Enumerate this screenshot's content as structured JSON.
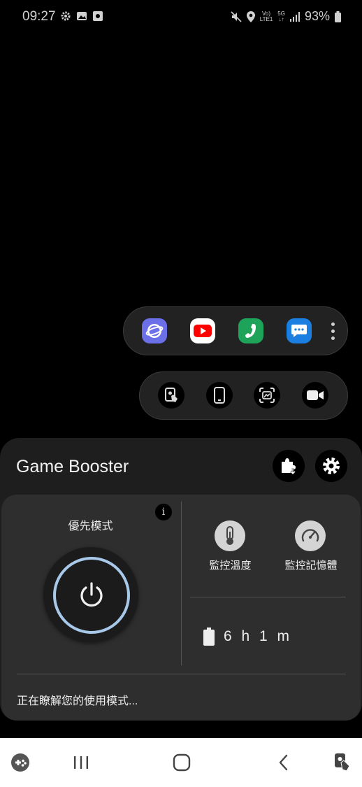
{
  "status_bar": {
    "time": "09:27",
    "battery_percent": "93%",
    "volte_top": "Vo)",
    "volte_bottom": "LTE1",
    "network_top": "5G",
    "network_bottom": "↓↑"
  },
  "floating_apps": [
    {
      "name": "Samsung Internet",
      "icon": "internet-icon",
      "color": "#6b6fe8"
    },
    {
      "name": "YouTube",
      "icon": "youtube-icon",
      "color": "#ffffff"
    },
    {
      "name": "Phone",
      "icon": "phone-icon",
      "color": "#1ea35a"
    },
    {
      "name": "Messages",
      "icon": "messages-icon",
      "color": "#1a7fe0"
    }
  ],
  "tools": [
    "touch-lock-icon",
    "screen-orientation-icon",
    "screenshot-icon",
    "record-icon"
  ],
  "game_booster": {
    "title": "Game Booster",
    "priority_mode_label": "優先模式",
    "info_glyph": "i",
    "monitor_temperature_label": "監控溫度",
    "monitor_memory_label": "監控記憶體",
    "battery_time": "6 h 1 m",
    "learning_text": "正在瞭解您的使用模式..."
  },
  "colors": {
    "accent_ring": "#a8c8ea",
    "panel": "#1e1e1e",
    "card": "#2e2e2e"
  }
}
